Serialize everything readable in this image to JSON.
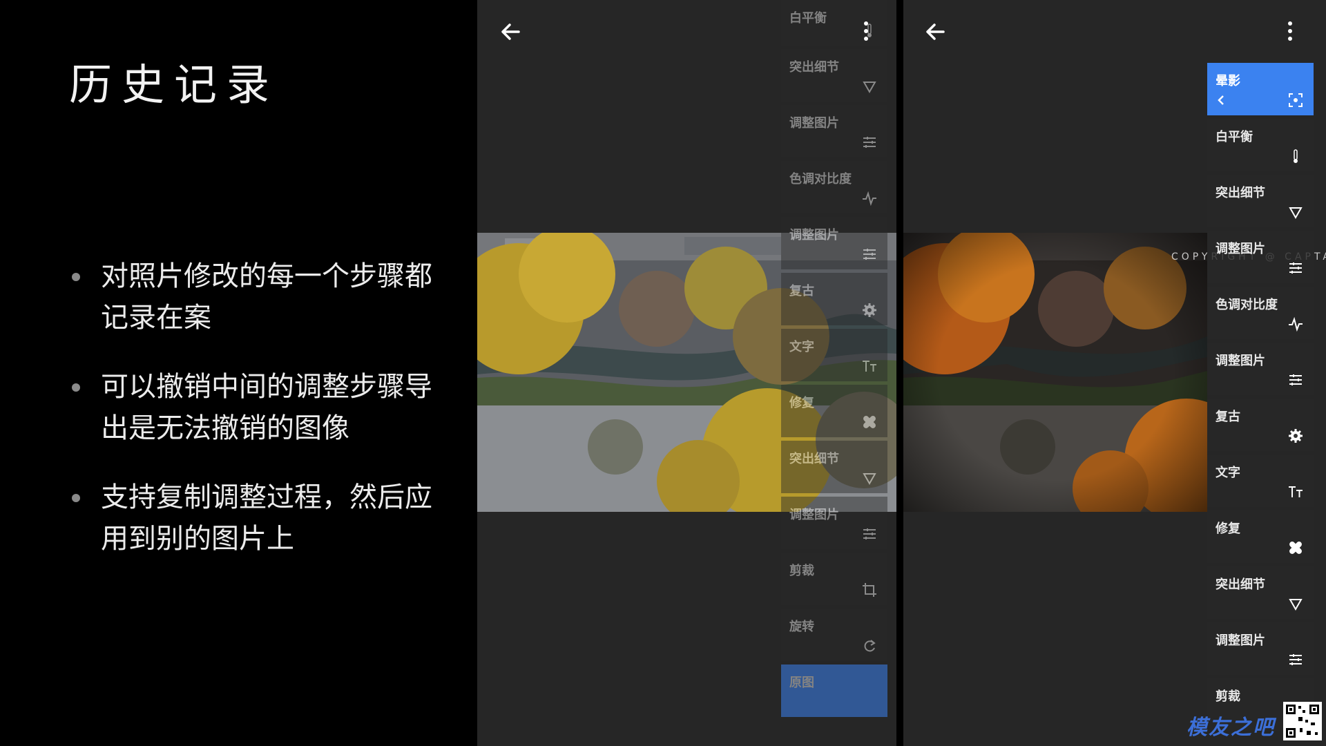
{
  "slide": {
    "title": "历史记录",
    "bullets": [
      "对照片修改的每一个步骤都记录在案",
      "可以撤销中间的调整步骤导出是无法撤销的图像",
      "支持复制调整过程，然后应用到别的图片上"
    ]
  },
  "left_phone": {
    "history": [
      {
        "label": "白平衡",
        "icon": "thermometer-icon"
      },
      {
        "label": "突出细节",
        "icon": "triangle-down-icon"
      },
      {
        "label": "调整图片",
        "icon": "sliders-icon"
      },
      {
        "label": "色调对比度",
        "icon": "pulse-icon"
      },
      {
        "label": "调整图片",
        "icon": "sliders-icon"
      },
      {
        "label": "复古",
        "icon": "gear-icon"
      },
      {
        "label": "文字",
        "icon": "text-icon"
      },
      {
        "label": "修复",
        "icon": "bandage-icon"
      },
      {
        "label": "突出细节",
        "icon": "triangle-down-icon"
      },
      {
        "label": "调整图片",
        "icon": "sliders-icon"
      },
      {
        "label": "剪裁",
        "icon": "crop-icon"
      },
      {
        "label": "旋转",
        "icon": "rotate-icon"
      },
      {
        "label": "原图",
        "icon": "",
        "active": true
      }
    ]
  },
  "right_phone": {
    "watermark_text": "COPYRIGHT @ CAPTAIN",
    "history": [
      {
        "label": "晕影",
        "icon": "vignette-icon",
        "active": true
      },
      {
        "label": "白平衡",
        "icon": "thermometer-icon"
      },
      {
        "label": "突出细节",
        "icon": "triangle-down-icon"
      },
      {
        "label": "调整图片",
        "icon": "sliders-icon"
      },
      {
        "label": "色调对比度",
        "icon": "pulse-icon"
      },
      {
        "label": "调整图片",
        "icon": "sliders-icon"
      },
      {
        "label": "复古",
        "icon": "gear-icon"
      },
      {
        "label": "文字",
        "icon": "text-icon"
      },
      {
        "label": "修复",
        "icon": "bandage-icon"
      },
      {
        "label": "突出细节",
        "icon": "triangle-down-icon"
      },
      {
        "label": "调整图片",
        "icon": "sliders-icon"
      },
      {
        "label": "剪裁",
        "icon": "crop-icon"
      }
    ]
  },
  "footer_watermark": "模友之吧",
  "colors": {
    "accent": "#3b82f0",
    "panel_bg": "#262626"
  }
}
